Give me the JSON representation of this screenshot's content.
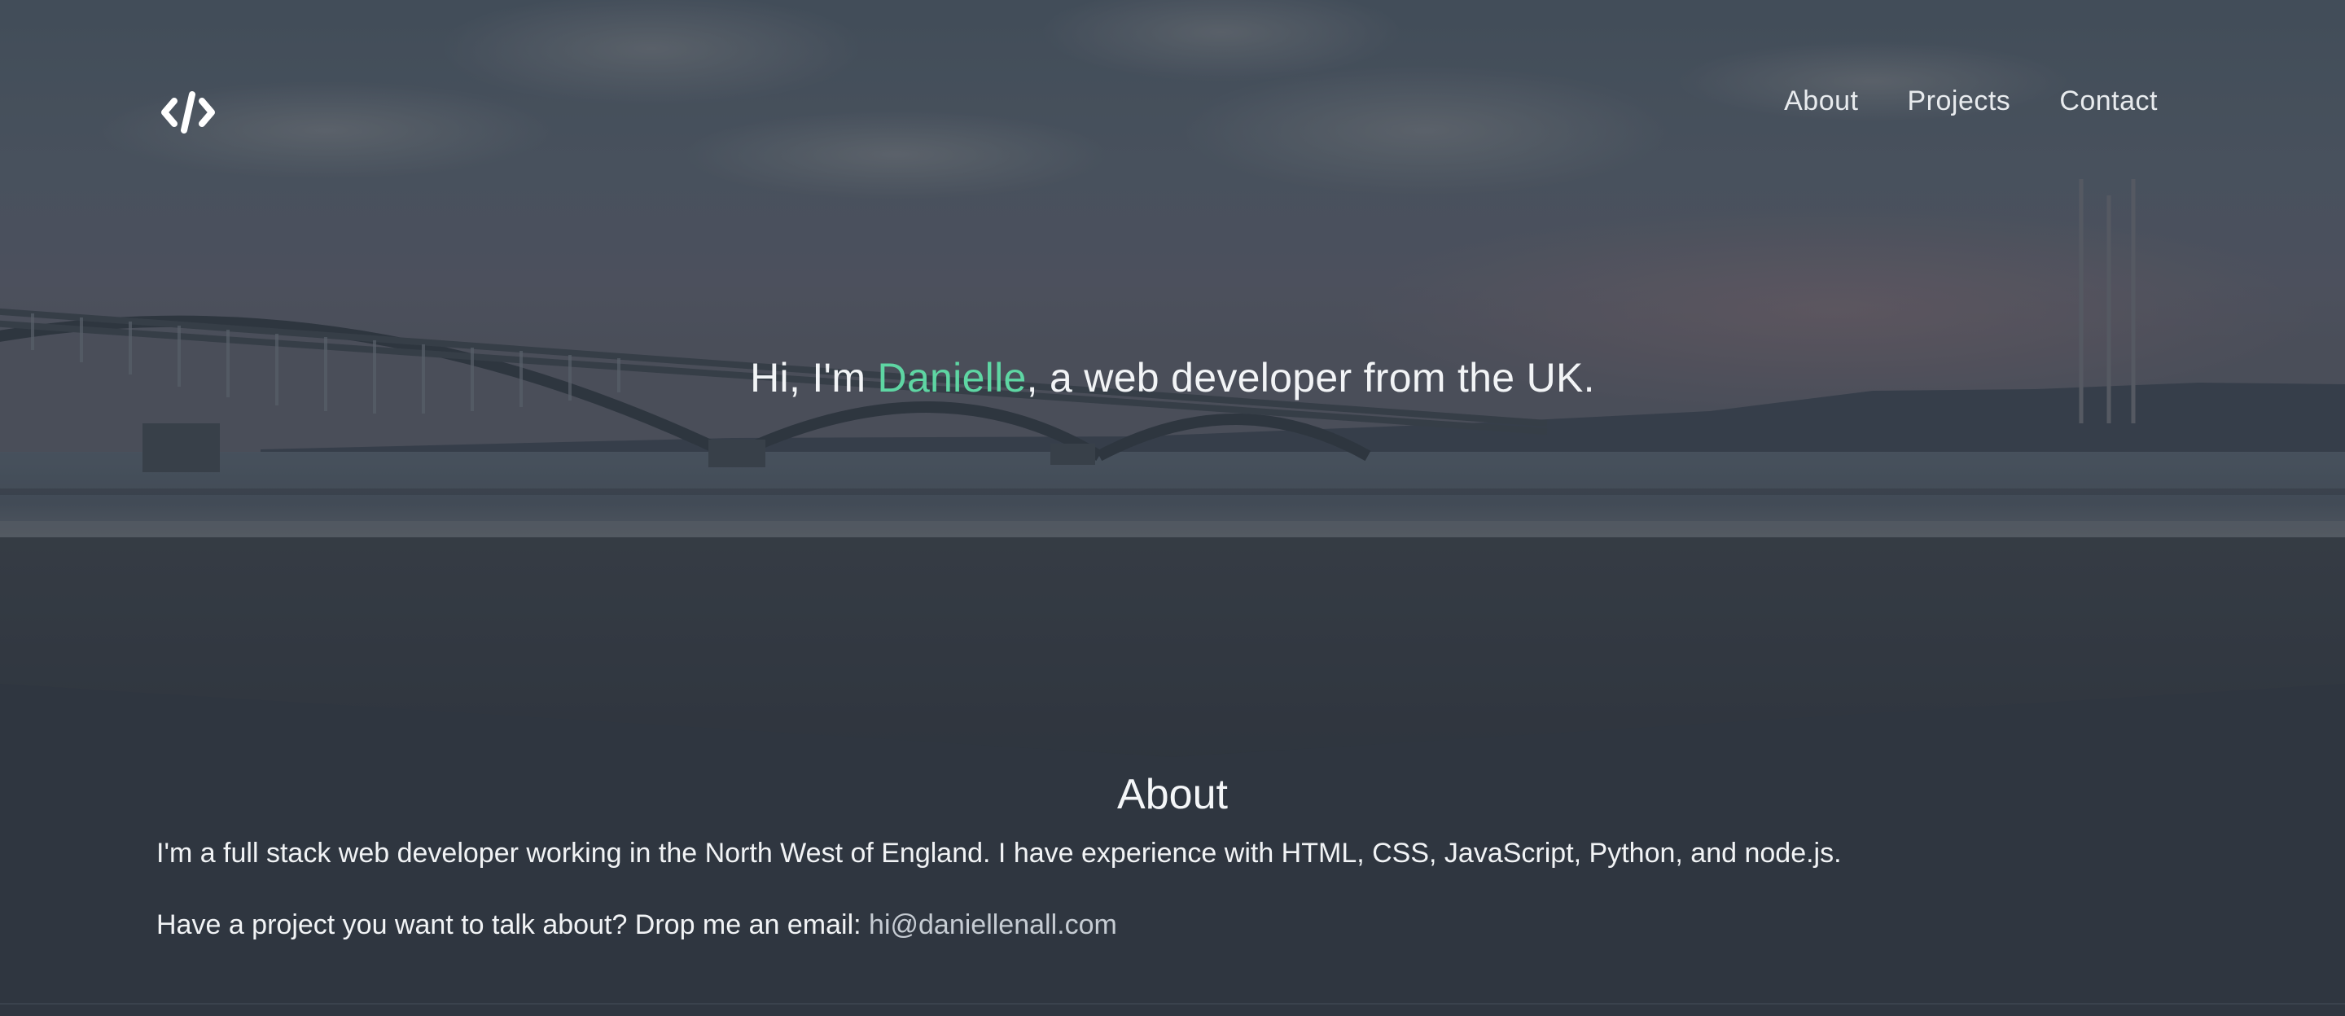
{
  "header": {
    "logo_alt": "</>",
    "nav": [
      {
        "label": "About"
      },
      {
        "label": "Projects"
      },
      {
        "label": "Contact"
      }
    ]
  },
  "hero": {
    "greeting": "Hi, I'm ",
    "name": "Danielle",
    "tagline": ", a web developer from the UK.",
    "accent_color": "#5ed6a3",
    "overlay_color": "#2f3640"
  },
  "about": {
    "title": "About",
    "paragraph_1": "I'm a full stack web developer working in the North West of England. I have experience with HTML, CSS, JavaScript, Python, and node.js.",
    "paragraph_2_prefix": "Have a project you want to talk about? Drop me an email: ",
    "email": "hi@daniellenall.com"
  }
}
